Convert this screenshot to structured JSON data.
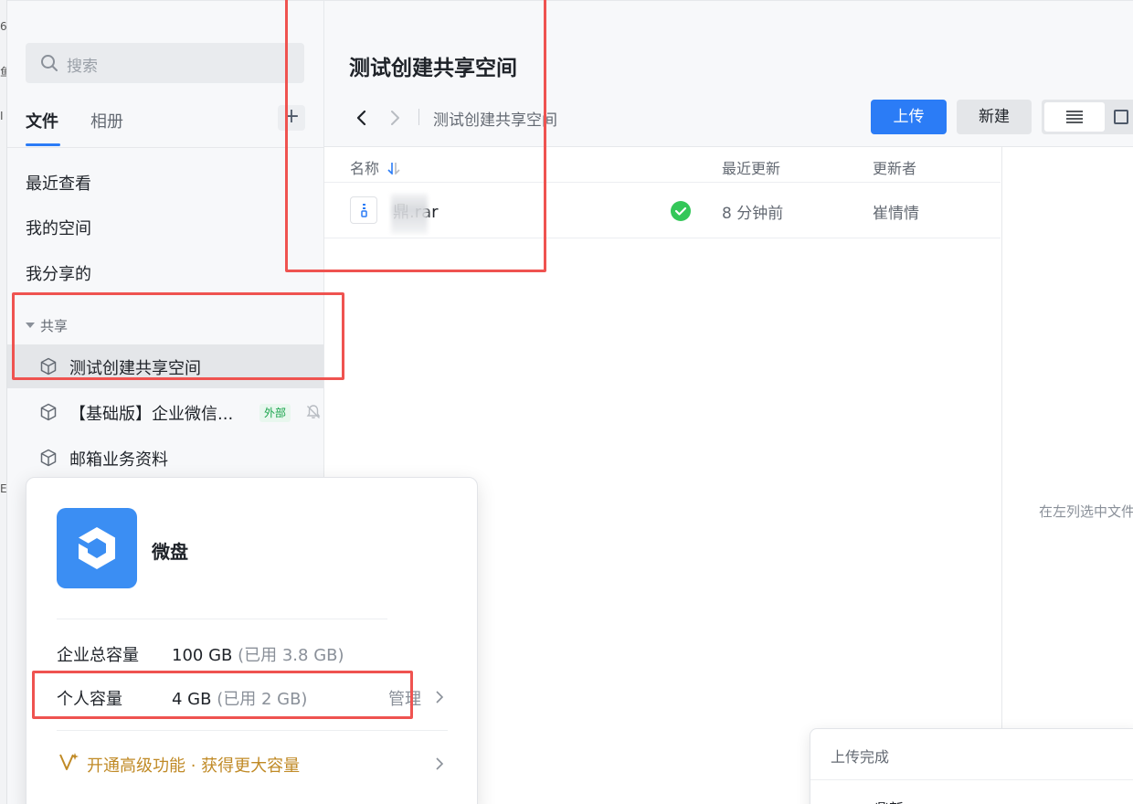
{
  "colors": {
    "accent": "#2b7cf6",
    "success": "#34c759",
    "upgrade": "#c08a26",
    "annotation": "#ef5350"
  },
  "outer_window": {
    "glyphs": [
      "6",
      "鱼",
      "I",
      "E"
    ]
  },
  "sidebar": {
    "search_placeholder": "搜索",
    "tabs": [
      {
        "label": "文件",
        "active": true
      },
      {
        "label": "相册",
        "active": false
      }
    ],
    "add_icon": "plus-icon",
    "nav_items": [
      {
        "label": "最近查看"
      },
      {
        "label": "我的空间"
      },
      {
        "label": "我分享的"
      }
    ],
    "shared_group": {
      "label": "共享",
      "items": [
        {
          "label": "测试创建共享空间",
          "selected": true
        },
        {
          "label": "【基础版】企业微信...",
          "badge": "外部",
          "muted": true
        },
        {
          "label": "邮箱业务资料"
        }
      ]
    }
  },
  "header": {
    "title": "测试创建共享空间",
    "breadcrumb": "测试创建共享空间",
    "upload_button": "上传",
    "new_button": "新建",
    "view_mode": "list"
  },
  "file_list": {
    "columns": {
      "name": "名称",
      "updated": "最近更新",
      "updater": "更新者"
    },
    "rows": [
      {
        "name": "鼎",
        "ext": ".rar",
        "status": "synced",
        "updated": "8 分钟前",
        "updater": "崔情情"
      }
    ]
  },
  "detail_panel": {
    "hint": "在左列选中文件"
  },
  "storage_popup": {
    "app_name": "微盘",
    "enterprise": {
      "label": "企业总容量",
      "total": "100 GB",
      "used": "(已用 3.8 GB)"
    },
    "personal": {
      "label": "个人容量",
      "total": "4 GB",
      "used": "(已用 2 GB)",
      "action": "管理"
    },
    "upgrade": "开通高级功能 · 获得更大容量"
  },
  "toast": {
    "title": "上传完成",
    "file": "鼎新"
  }
}
